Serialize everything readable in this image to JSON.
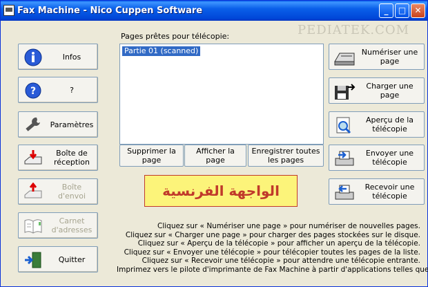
{
  "window": {
    "title": "Fax Machine   -   Nico Cuppen Software",
    "minimize_glyph": "_",
    "maximize_glyph": "□",
    "close_glyph": "✕",
    "watermark": "PEDIATEK.COM"
  },
  "left_buttons": [
    {
      "label": "Infos",
      "icon": "info-icon",
      "enabled": true
    },
    {
      "label": "?",
      "icon": "help-icon",
      "enabled": true
    },
    {
      "label": "Paramètres",
      "icon": "wrench-icon",
      "enabled": true
    },
    {
      "label": "Boîte de réception",
      "icon": "inbox-tray-icon",
      "enabled": true
    },
    {
      "label": "Boîte d'envoi",
      "icon": "outbox-tray-icon",
      "enabled": false
    },
    {
      "label": "Carnet d'adresses",
      "icon": "address-book-icon",
      "enabled": false
    },
    {
      "label": "Quitter",
      "icon": "exit-door-icon",
      "enabled": true
    }
  ],
  "pages": {
    "label": "Pages prêtes pour télécopie:",
    "items": [
      "Partie 01 (scanned)"
    ]
  },
  "page_actions": {
    "delete": "Supprimer la page",
    "show": "Afficher la page",
    "save_all": "Enregistrer toutes les pages"
  },
  "arabic_text": "الواجهة الفرنسية",
  "right_buttons": [
    {
      "label": "Numériser une page",
      "icon": "scanner-icon",
      "enabled": true
    },
    {
      "label": "Charger une page",
      "icon": "floppy-load-icon",
      "enabled": true
    },
    {
      "label": "Aperçu de la télécopie",
      "icon": "preview-magnifier-icon",
      "enabled": true
    },
    {
      "label": "Envoyer une télécopie",
      "icon": "fax-send-icon",
      "enabled": true
    },
    {
      "label": "Recevoir une télécopie",
      "icon": "fax-receive-icon",
      "enabled": true
    }
  ],
  "help_lines": [
    "Cliquez sur «   Numériser une page   » pour numériser de nouvelles pages.",
    "Cliquez sur «   Charger une page   » pour charger des pages stockées sur le disque.",
    "Cliquez sur «   Aperçu de la télécopie   » pour afficher un aperçu de la télécopie.",
    "Cliquez sur «   Envoyer une télécopie   » pour télécopier toutes les pages de la liste.",
    "Cliquez sur «   Recevoir une télécopie   » pour attendre une télécopie entrante.",
    "Imprimez vers le pilote d'imprimante de Fax Machine à partir d'applications telles que"
  ]
}
